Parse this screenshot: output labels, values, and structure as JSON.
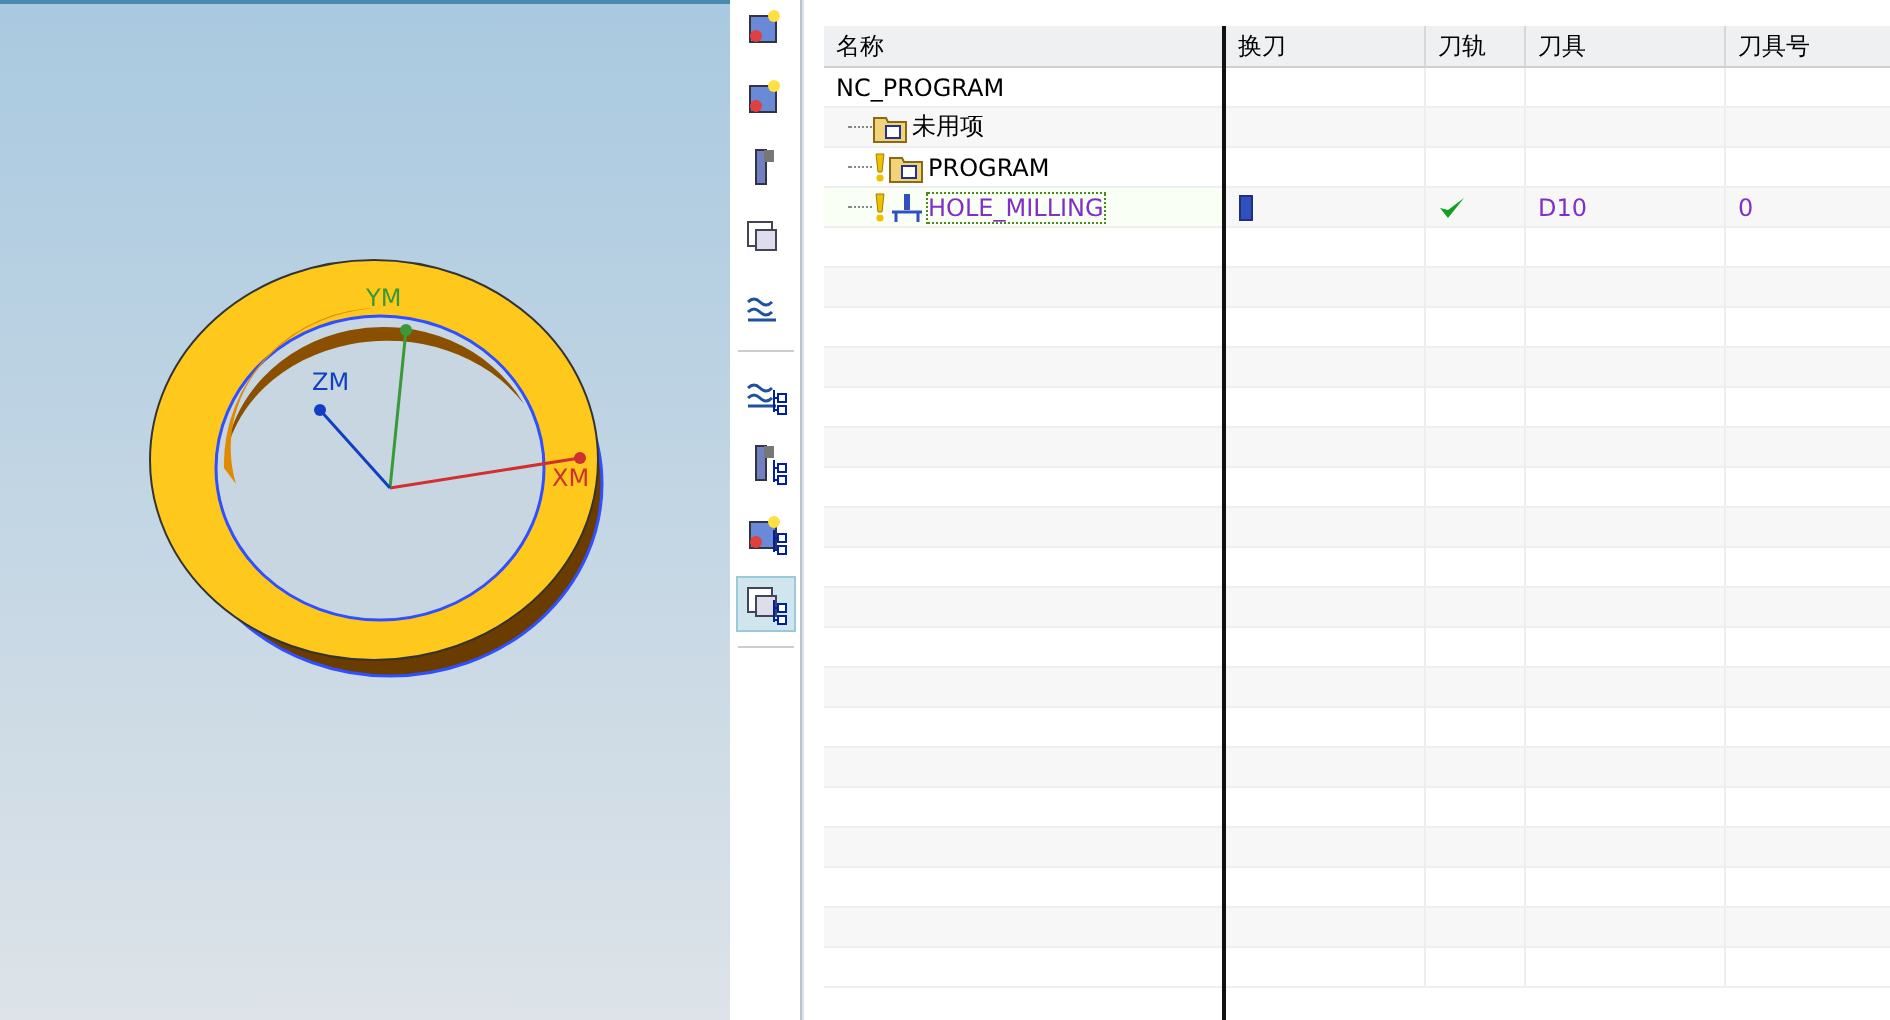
{
  "viewport": {
    "axes": [
      {
        "kind": "x",
        "label": "XM"
      },
      {
        "kind": "y",
        "label": "YM"
      },
      {
        "kind": "z",
        "label": "ZM"
      }
    ]
  },
  "toolbar": {
    "buttons": [
      {
        "kind": "geometry",
        "selected": false
      },
      {
        "kind": "block",
        "selected": false
      },
      {
        "kind": "tool",
        "selected": false
      },
      {
        "kind": "grid",
        "selected": false
      },
      {
        "kind": "water",
        "selected": false
      },
      {
        "kind": "water-tree",
        "selected": false
      },
      {
        "kind": "tool-tree",
        "selected": false
      },
      {
        "kind": "block-tree",
        "selected": false
      },
      {
        "kind": "grid-tree",
        "selected": true
      }
    ]
  },
  "table": {
    "columns": [
      "名称",
      "换刀",
      "刀轨",
      "刀具",
      "刀具号"
    ],
    "rows": [
      {
        "name": "NC_PROGRAM",
        "selected": false,
        "children": [
          {
            "name": "未用项",
            "kind": "group",
            "warning": false,
            "tool_change": false,
            "path_ok": false,
            "selected": false
          },
          {
            "name": "PROGRAM",
            "kind": "group",
            "warning": true,
            "tool_change": false,
            "path_ok": false,
            "selected": false
          },
          {
            "name": "HOLE_MILLING",
            "kind": "operation",
            "warning": true,
            "tool_change": true,
            "path_ok": true,
            "tool": "D10",
            "tool_number": "0",
            "selected": true
          }
        ]
      }
    ]
  }
}
